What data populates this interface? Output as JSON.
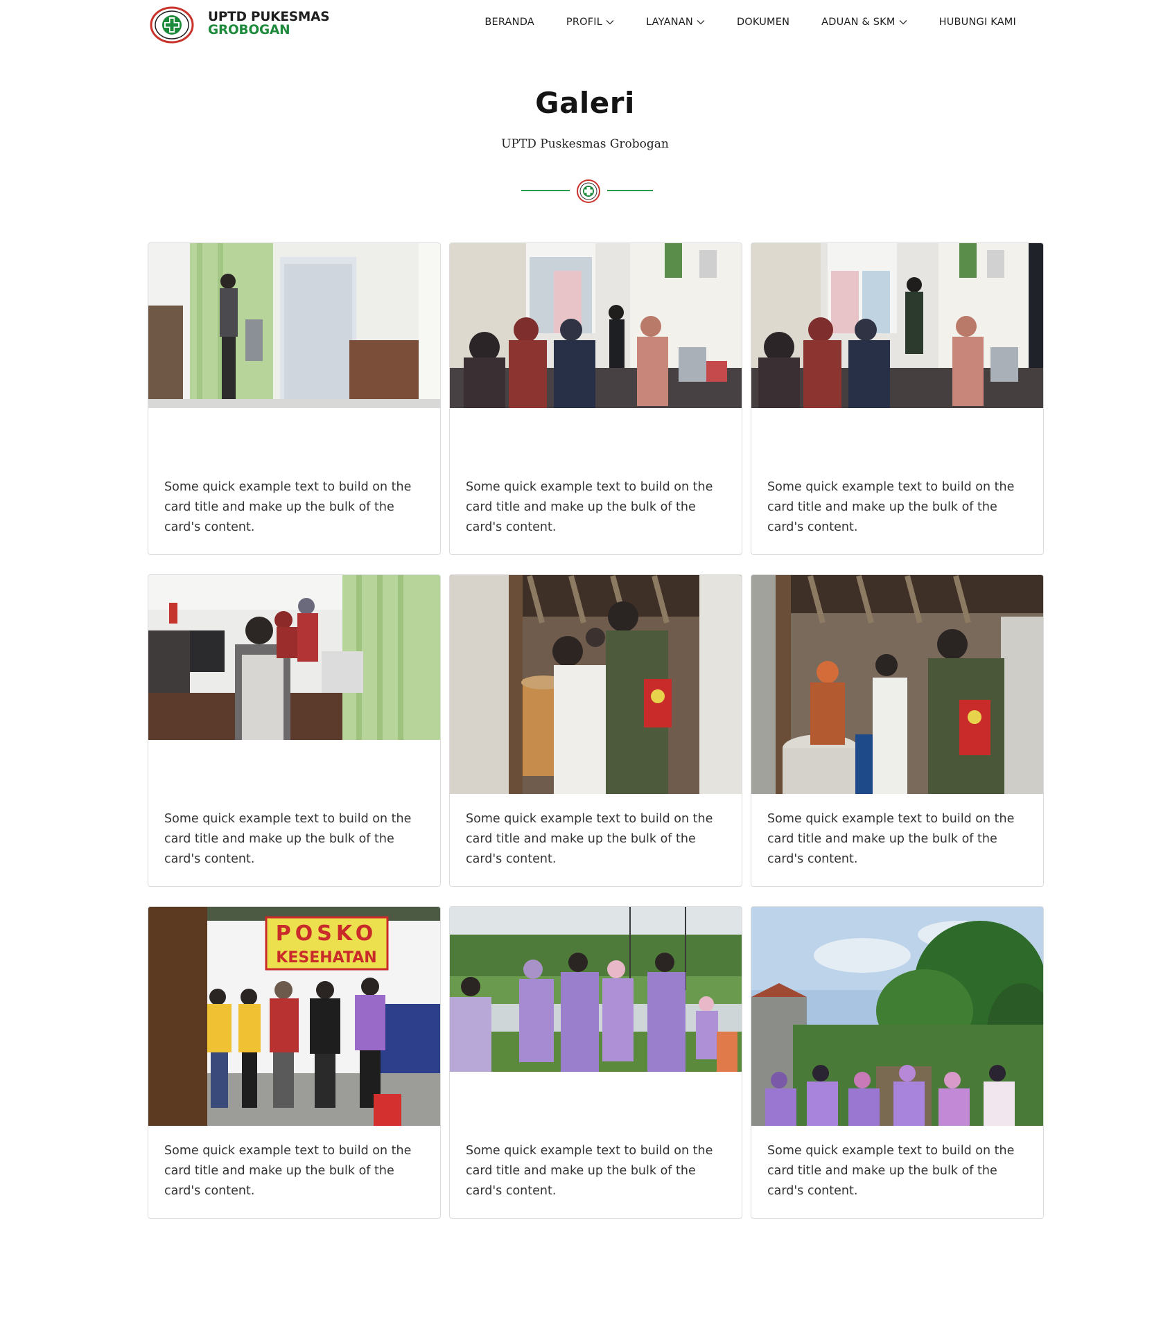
{
  "header": {
    "brand_line1": "UPTD PUKESMAS",
    "brand_line2": "GROBOGAN",
    "nav": [
      {
        "label": "BERANDA",
        "dropdown": false
      },
      {
        "label": "PROFIL",
        "dropdown": true
      },
      {
        "label": "LAYANAN",
        "dropdown": true
      },
      {
        "label": "DOKUMEN",
        "dropdown": false
      },
      {
        "label": "ADUAN & SKM",
        "dropdown": true
      },
      {
        "label": "HUBUNGI KAMI",
        "dropdown": false
      }
    ]
  },
  "hero": {
    "title": "Galeri",
    "subtitle": "UPTD Puskesmas Grobogan"
  },
  "gallery": {
    "cards": [
      {
        "photo": "clinic-room-patient-photo",
        "text": "Some quick example text to build on the card title and make up the bulk of the card's content."
      },
      {
        "photo": "waiting-room-crowd-photo",
        "text": "Some quick example text to build on the card title and make up the bulk of the card's content."
      },
      {
        "photo": "waiting-room-crowd-photo-2",
        "text": "Some quick example text to build on the card title and make up the bulk of the card's content."
      },
      {
        "photo": "registration-desk-photo",
        "text": "Some quick example text to build on the card title and make up the bulk of the card's content."
      },
      {
        "photo": "home-visit-inspection-photo",
        "text": "Some quick example text to build on the card title and make up the bulk of the card's content."
      },
      {
        "photo": "home-visit-inspection-photo-2",
        "text": "Some quick example text to build on the card title and make up the bulk of the card's content."
      },
      {
        "photo": "posko-kesehatan-team-photo",
        "text": "Some quick example text to build on the card title and make up the bulk of the card's content."
      },
      {
        "photo": "field-team-group-photo",
        "text": "Some quick example text to build on the card title and make up the bulk of the card's content."
      },
      {
        "photo": "village-outreach-group-photo",
        "text": "Some quick example text to build on the card title and make up the bulk of the card's content."
      }
    ],
    "poster_text": {
      "line1": "POSKO",
      "line2": "KESEHATAN"
    }
  },
  "colors": {
    "brand_green": "#1e8a3c",
    "logo_red": "#c8342c",
    "divider_green": "#2a9b4a"
  }
}
